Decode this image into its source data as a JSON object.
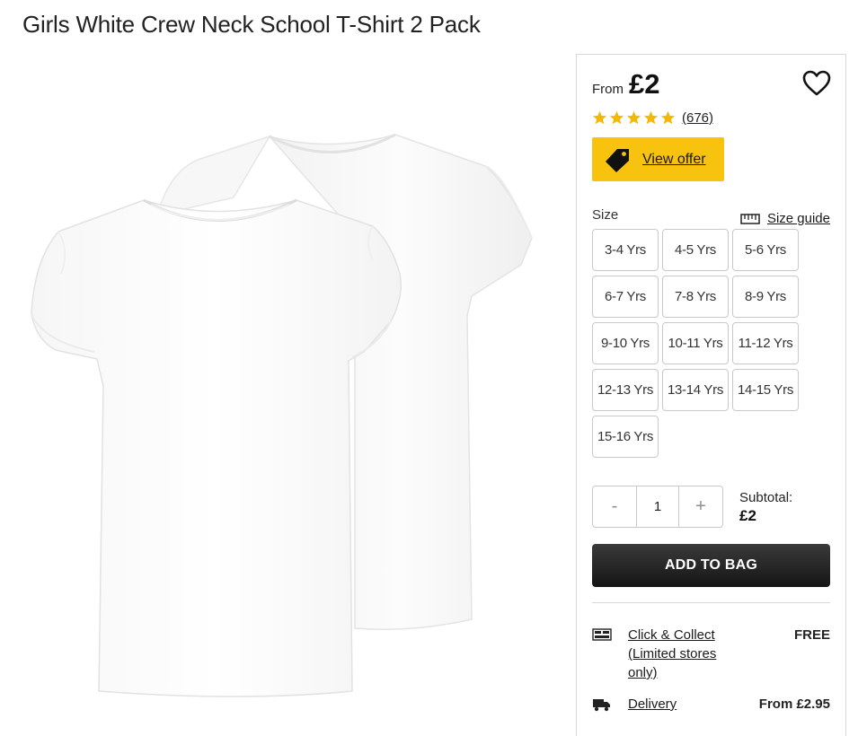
{
  "product": {
    "title": "Girls White Crew Neck School T-Shirt 2 Pack"
  },
  "panel": {
    "from_label": "From",
    "price": "£2",
    "rating": {
      "stars": 5,
      "max": 5,
      "reviews": "(676)"
    },
    "offer_label": "View offer",
    "size_label": "Size",
    "size_guide_label": "Size guide",
    "sizes": [
      "3-4 Yrs",
      "4-5 Yrs",
      "5-6 Yrs",
      "6-7 Yrs",
      "7-8 Yrs",
      "8-9 Yrs",
      "9-10 Yrs",
      "10-11 Yrs",
      "11-12 Yrs",
      "12-13 Yrs",
      "13-14 Yrs",
      "14-15 Yrs",
      "15-16 Yrs"
    ],
    "quantity": {
      "minus": "-",
      "value": "1",
      "plus": "+"
    },
    "subtotal_label": "Subtotal:",
    "subtotal_value": "£2",
    "add_to_bag": "ADD TO BAG",
    "delivery": [
      {
        "label": "Click & Collect (Limited stores only)",
        "price": "FREE",
        "icon": "click-collect-icon"
      },
      {
        "label": "Delivery",
        "price": "From £2.95",
        "icon": "truck-icon"
      }
    ]
  },
  "colors": {
    "offer_yellow": "#f7c30e",
    "star_yellow": "#f5b800",
    "button_dark": "#1e1e1e"
  }
}
